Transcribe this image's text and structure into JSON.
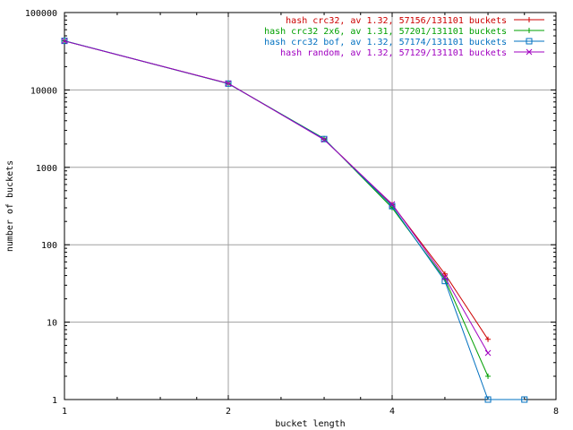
{
  "chart_data": {
    "type": "line",
    "xlabel": "bucket length",
    "ylabel": "number of buckets",
    "x_scale": "log2",
    "y_scale": "log10",
    "xlim": [
      1,
      8
    ],
    "ylim": [
      1,
      100000
    ],
    "x_ticks": [
      "1",
      "2",
      "4",
      "8"
    ],
    "x_tick_values": [
      1,
      2,
      4,
      8
    ],
    "y_ticks": [
      "1",
      "10",
      "100",
      "1000",
      "10000",
      "100000"
    ],
    "y_tick_values": [
      1,
      10,
      100,
      1000,
      10000,
      100000
    ],
    "grid": true,
    "legend_position": "top-right",
    "series": [
      {
        "name": "hash crc32, av 1.32, 57156/131101 buckets",
        "color": "#cc0000",
        "marker": "plus",
        "points": [
          [
            1,
            43000
          ],
          [
            2,
            12100
          ],
          [
            3,
            2300
          ],
          [
            4,
            330
          ],
          [
            5,
            42
          ],
          [
            6,
            6
          ]
        ]
      },
      {
        "name": "hash crc32 2x6, av 1.31, 57201/131101 buckets",
        "color": "#00a000",
        "marker": "plus",
        "points": [
          [
            1,
            43100
          ],
          [
            2,
            12050
          ],
          [
            3,
            2350
          ],
          [
            4,
            300
          ],
          [
            5,
            36
          ],
          [
            6,
            2
          ]
        ]
      },
      {
        "name": "hash crc32 bof, av 1.32, 57174/131101 buckets",
        "color": "#0070c0",
        "marker": "square",
        "points": [
          [
            1,
            43050
          ],
          [
            2,
            12080
          ],
          [
            3,
            2320
          ],
          [
            4,
            315
          ],
          [
            5,
            34
          ],
          [
            6,
            1
          ],
          [
            7,
            1
          ]
        ]
      },
      {
        "name": "hash random, av 1.32, 57129/131101 buckets",
        "color": "#a000c0",
        "marker": "cross",
        "points": [
          [
            1,
            42900
          ],
          [
            2,
            12150
          ],
          [
            3,
            2280
          ],
          [
            4,
            335
          ],
          [
            5,
            38
          ],
          [
            6,
            4
          ]
        ]
      }
    ]
  }
}
